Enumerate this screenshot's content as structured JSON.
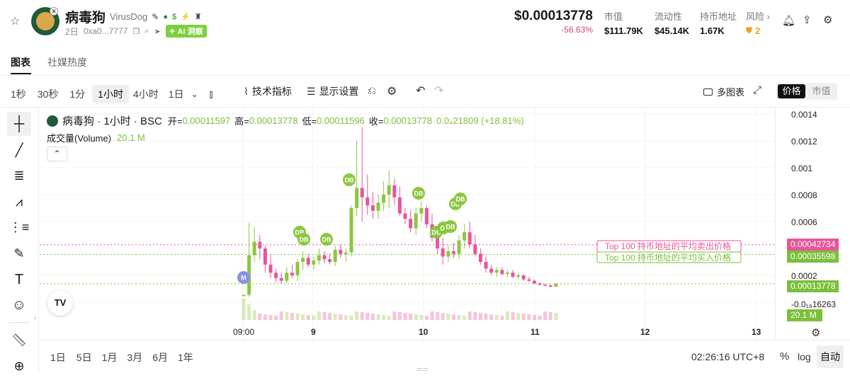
{
  "header": {
    "name": "病毒狗",
    "ticker": "VirusDog",
    "age": "2日",
    "address": "0xa0...7777",
    "ai_badge": "AI 洞察",
    "price": "$0.00013778",
    "change": "-56.63%",
    "stats": [
      {
        "label": "市值",
        "value": "$111.79K"
      },
      {
        "label": "流动性",
        "value": "$45.14K"
      },
      {
        "label": "持币地址",
        "value": "1.67K"
      },
      {
        "label": "风险 ›",
        "value": "2"
      }
    ]
  },
  "tabs": [
    "图表",
    "社媒热度"
  ],
  "toolbar": {
    "intervals": [
      "1秒",
      "30秒",
      "1分",
      "1小时",
      "4小时",
      "1日"
    ],
    "active_interval": "1小时",
    "indicators": "技术指标",
    "display": "显示设置",
    "multi": "多图表",
    "price_btn": "价格",
    "mcap_btn": "市值"
  },
  "legend": {
    "title": "病毒狗 · 1小时 · BSC",
    "open_lbl": "开=",
    "open": "0.00011597",
    "high_lbl": "高=",
    "high": "0.00013778",
    "low_lbl": "低=",
    "low": "0.00011596",
    "close_lbl": "收=",
    "close": "0.00013778",
    "change": "0.0₄21809 (+18.81%)",
    "volume_lbl": "成交量(Volume)",
    "volume_val": "20.1 M"
  },
  "chart_data": {
    "type": "candlestick",
    "x_ticks": [
      "09:00",
      "9",
      "10",
      "11",
      "12",
      "13"
    ],
    "y_ticks": [
      "0.0014",
      "0.0012",
      "0.001",
      "0.0008",
      "0.0006",
      "0.0002",
      "-0.0₁₈16263"
    ],
    "ylim": [
      -0.00014,
      0.0014
    ],
    "price_tags": [
      {
        "value": "0.00042734",
        "color": "#e8559a"
      },
      {
        "value": "0.00035598",
        "color": "#7bbf3a"
      },
      {
        "value": "0.00013778",
        "color": "#7bbf3a"
      },
      {
        "value": "20.1 M",
        "color": "#7bbf3a"
      }
    ],
    "lines": {
      "sell_label": "Top 100 持币地址的平均卖出价格",
      "buy_label": "Top 100 持币地址的平均买入价格",
      "sell_price": 0.00042734,
      "buy_price": 0.00035598,
      "last_price": 0.00013778
    },
    "markers": [
      "M",
      "DB",
      "DB",
      "DB",
      "DB",
      "DB",
      "DB",
      "DI",
      "DB",
      "DB",
      "DB"
    ]
  },
  "bottom": {
    "ranges": [
      "1日",
      "5日",
      "1月",
      "3月",
      "6月",
      "1年"
    ],
    "time": "02:26:16 UTC+8",
    "pct": "%",
    "log": "log",
    "auto": "自动"
  },
  "colors": {
    "up": "#8cc63f",
    "down": "#e8559a",
    "accent": "#7bbf3a"
  }
}
